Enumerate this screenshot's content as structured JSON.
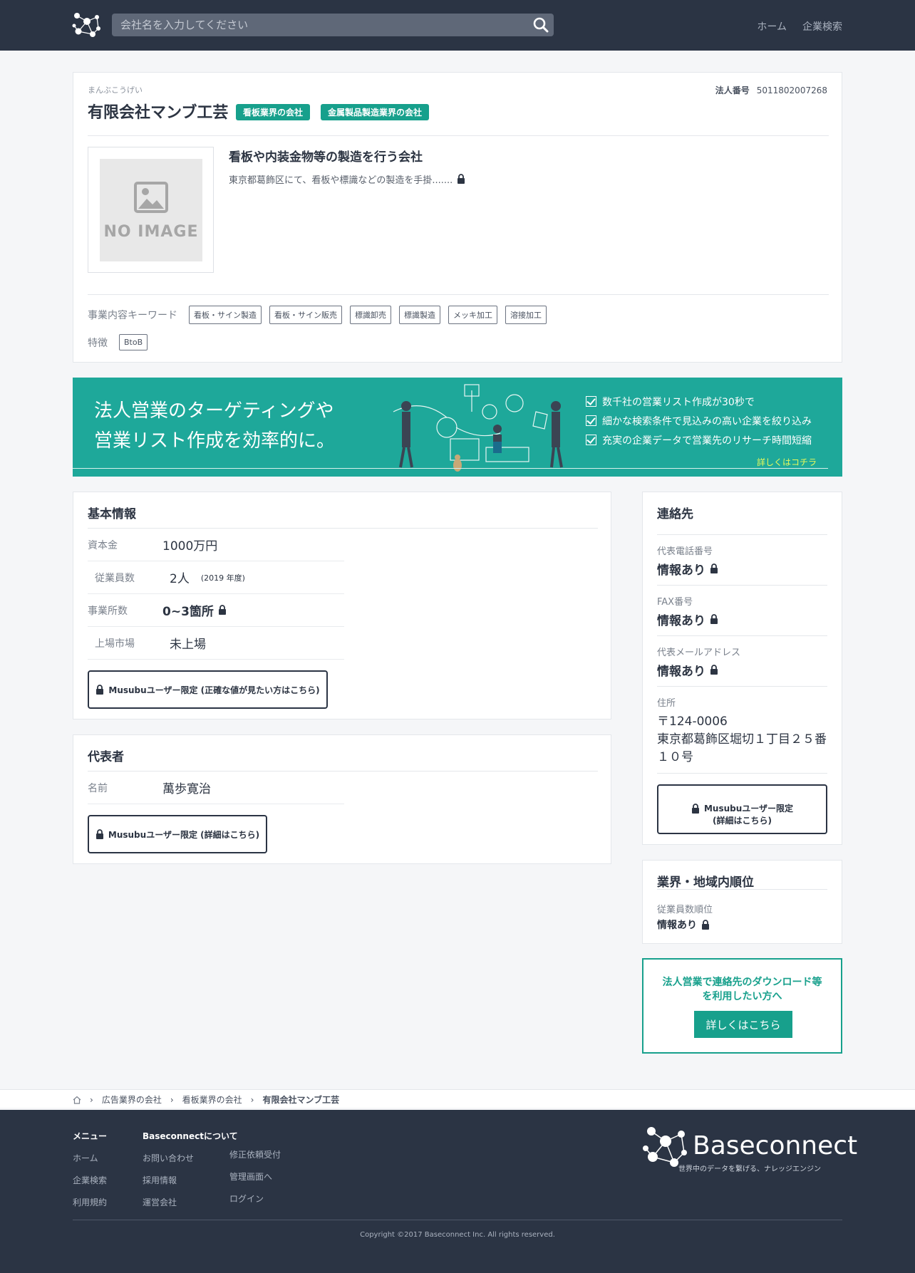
{
  "header": {
    "search_placeholder": "会社名を入力してください",
    "nav": [
      "ホーム",
      "企業検索"
    ]
  },
  "company": {
    "kana": "まんぶこうげい",
    "name": "有限会社マンブ工芸",
    "badges": [
      "看板業界の会社",
      "金属製品製造業界の会社"
    ],
    "corp_no_label": "法人番号",
    "corp_no": "5011802007268",
    "noimage_text": "NO IMAGE",
    "tagline": "看板や内装金物等の製造を行う会社",
    "description": "東京都葛飾区にて、看板や標識などの製造を手掛.......",
    "keywords_label": "事業内容キーワード",
    "keywords": [
      "看板・サイン製造",
      "看板・サイン販売",
      "標識卸売",
      "標識製造",
      "メッキ加工",
      "溶接加工"
    ],
    "features_label": "特徴",
    "features": [
      "BtoB"
    ]
  },
  "banner": {
    "headline1": "法人営業のターゲティングや",
    "headline2": "営業リスト作成を効率的に。",
    "points": [
      "数千社の営業リスト作成が30秒で",
      "細かな検索条件で見込みの高い企業を絞り込み",
      "充実の企業データで営業先のリサーチ時間短縮"
    ],
    "link": "詳しくはコチラ"
  },
  "basic": {
    "title": "基本情報",
    "rows": [
      {
        "key": "資本金",
        "value": "1000万円",
        "sub": ""
      },
      {
        "key": "従業員数",
        "value": "2人",
        "sub": "(2019 年度)"
      },
      {
        "key": "事業所数",
        "value": "0~3箇所",
        "sub": ""
      },
      {
        "key": "上場市場",
        "value": "未上場",
        "sub": ""
      }
    ],
    "button": "Musubuユーザー限定 (正確な値が見たい方はこちら)"
  },
  "representative": {
    "title": "代表者",
    "name_key": "名前",
    "name_value": "萬歩寛治",
    "button": "Musubuユーザー限定 (詳細はこちら)"
  },
  "contact": {
    "title": "連絡先",
    "phone_key": "代表電話番号",
    "phone_value": "情報あり",
    "fax_key": "FAX番号",
    "fax_value": "情報あり",
    "mail_key": "代表メールアドレス",
    "mail_value": "情報あり",
    "addr_key": "住所",
    "addr_zip": "〒124-0006",
    "addr_line": "東京都葛飾区堀切１丁目２５番１０号",
    "button_line1": "Musubuユーザー限定",
    "button_line2": "(詳細はこちら)"
  },
  "ranking": {
    "title": "業界・地域内順位",
    "key": "従業員数順位",
    "value": "情報あり"
  },
  "cta": {
    "line1": "法人営業で連絡先のダウンロード等",
    "line2": "を利用したい方へ",
    "button": "詳しくはこちら"
  },
  "breadcrumb": [
    "広告業界の会社",
    "看板業界の会社",
    "有限会社マンブ工芸"
  ],
  "footer": {
    "menu_title": "メニュー",
    "menu": [
      "ホーム",
      "企業検索",
      "利用規約"
    ],
    "about_title": "Baseconnectについて",
    "about_col1": [
      "お問い合わせ",
      "採用情報",
      "運営会社"
    ],
    "about_col2": [
      "修正依頼受付",
      "管理画面へ",
      "ログイン"
    ],
    "brand": "Baseconnect",
    "brand_sub": "世界中のデータを繋げる、ナレッジエンジン",
    "copyright": "Copyright ©2017 Baseconnect Inc. All rights reserved."
  }
}
